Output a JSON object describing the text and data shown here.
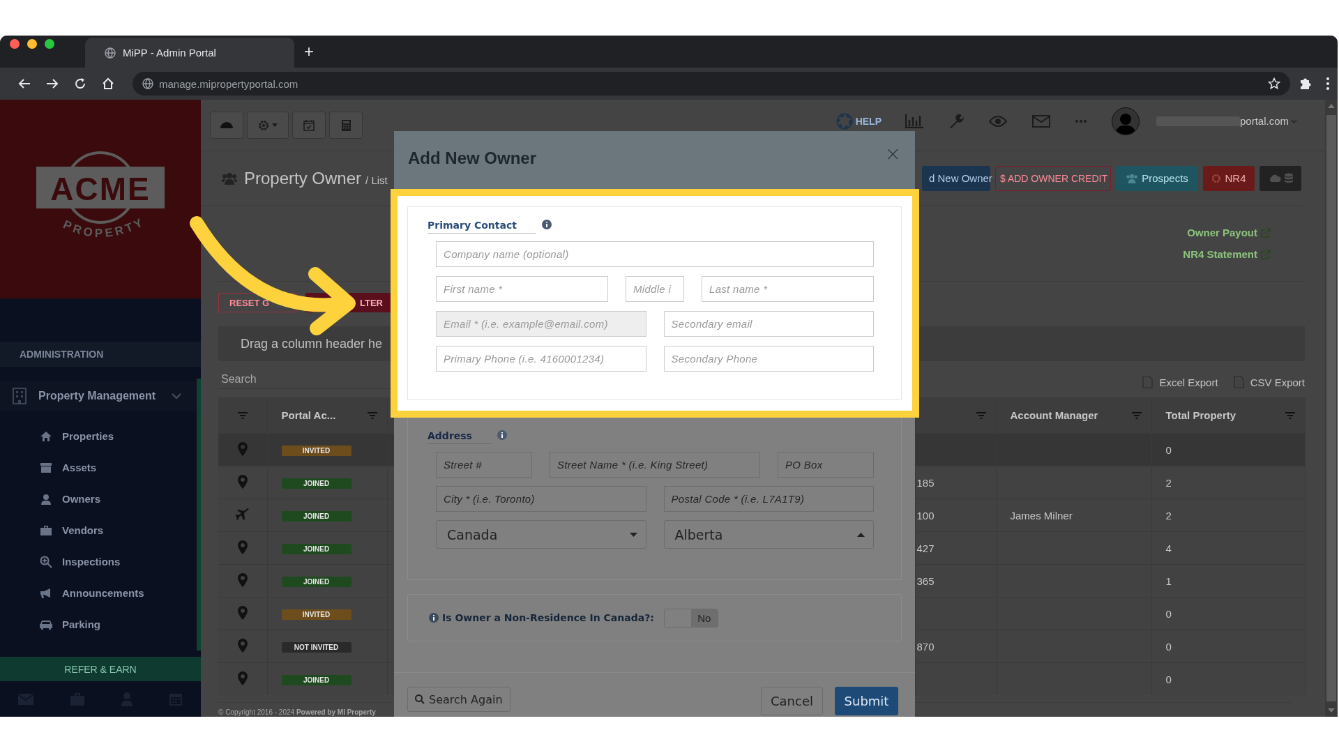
{
  "browser": {
    "tab_title": "MiPP - Admin Portal",
    "new_tab": "+",
    "url": "manage.mipropertyportal.com"
  },
  "logo": {
    "name": "ACME",
    "tagline": "PROPERTY"
  },
  "sidebar": {
    "section": "ADMINISTRATION",
    "group": {
      "label": "Property Management",
      "expanded": true
    },
    "items": [
      {
        "label": "Properties"
      },
      {
        "label": "Assets"
      },
      {
        "label": "Owners"
      },
      {
        "label": "Vendors"
      },
      {
        "label": "Inspections"
      },
      {
        "label": "Announcements"
      },
      {
        "label": "Parking"
      }
    ],
    "refer": "REFER & EARN"
  },
  "header": {
    "help": "HELP",
    "user_email": "portal.com"
  },
  "page": {
    "title": "Property Owner",
    "breadcrumb": "/ List",
    "actions": [
      {
        "label": "d New Owner",
        "kind": "primary"
      },
      {
        "label": "$ ADD OWNER CREDIT",
        "kind": "outline"
      },
      {
        "label": "Prospects",
        "kind": "info"
      },
      {
        "label": "NR4",
        "kind": "danger"
      },
      {
        "kind": "dark"
      }
    ],
    "links": [
      "Owner Payout",
      "NR4 Statement"
    ],
    "grid_buttons": [
      {
        "label": "RESET G",
        "kind": "outline"
      },
      {
        "label": "LTER",
        "kind": "solid"
      }
    ],
    "group_hint": "Drag a column header he",
    "search": {
      "placeholder": "Search"
    },
    "exports": [
      "Excel Export",
      "CSV Export"
    ]
  },
  "table": {
    "columns": [
      "Portal Ac...",
      "Account Manager",
      "Total Property"
    ],
    "rows": [
      {
        "kind": "pin",
        "status": "INVITED",
        "color": "#6e4d1c",
        "total": "0",
        "selected": true
      },
      {
        "kind": "pin",
        "status": "JOINED",
        "color": "#1f4a1f",
        "column_4": "185",
        "total": "2",
        "selected": false
      },
      {
        "kind": "plane",
        "status": "JOINED",
        "color": "#1f4a1f",
        "column_4": "100",
        "account_manager": "James Milner",
        "total": "2",
        "selected": false
      },
      {
        "kind": "pin",
        "status": "JOINED",
        "color": "#1f4a1f",
        "column_4": "427",
        "total": "4",
        "selected": false
      },
      {
        "kind": "pin",
        "status": "JOINED",
        "color": "#1f4a1f",
        "column_4": "365",
        "total": "1",
        "selected": false
      },
      {
        "kind": "pin",
        "status": "INVITED",
        "color": "#6e4d1c",
        "total": "0",
        "selected": false
      },
      {
        "kind": "pin",
        "status": "NOT INVITED",
        "color": "#2a2a2a",
        "column_4": "870",
        "total": "0",
        "selected": false
      },
      {
        "kind": "pin",
        "status": "JOINED",
        "color": "#1f4a1f",
        "total": "0",
        "selected": false
      }
    ]
  },
  "footer": "© Copyright 2016 - 2024 **Powered by MI Property**",
  "modal": {
    "title": "Add New Owner",
    "close": "×",
    "primary_contact": {
      "legend": "Primary Contact",
      "rows": [
        {
          "fields": [
            {
              "kind": "text",
              "placeholder": "Company name (optional)",
              "disabled": false
            }
          ]
        },
        {
          "fields": [
            {
              "kind": "text",
              "placeholder": "First name *",
              "disabled": false
            },
            {
              "kind": "text",
              "placeholder": "Middle i",
              "disabled": false
            },
            {
              "kind": "text",
              "placeholder": "Last name *",
              "disabled": false
            }
          ]
        },
        {
          "fields": [
            {
              "kind": "text",
              "placeholder": "Email * (i.e. example@email.com)",
              "disabled": true
            },
            {
              "kind": "text",
              "placeholder": "Secondary email",
              "disabled": false
            }
          ]
        },
        {
          "fields": [
            {
              "kind": "text",
              "placeholder": "Primary Phone (i.e. 4160001234)",
              "disabled": false
            },
            {
              "kind": "text",
              "placeholder": "Secondary Phone",
              "disabled": false
            }
          ]
        }
      ]
    },
    "address": {
      "legend": "Address",
      "rows": [
        {
          "fields": [
            {
              "kind": "text",
              "placeholder": "Street #",
              "disabled": false
            },
            {
              "kind": "text",
              "placeholder": "Street Name * (i.e. King Street)",
              "disabled": false
            },
            {
              "kind": "text",
              "placeholder": "PO Box",
              "disabled": false
            }
          ]
        },
        {
          "fields": [
            {
              "kind": "text",
              "placeholder": "City * (i.e. Toronto)",
              "disabled": false
            },
            {
              "kind": "text",
              "placeholder": "Postal Code * (i.e. L7A1T9)",
              "disabled": false
            }
          ]
        },
        {
          "fields": [
            {
              "kind": "select",
              "value": "Canada",
              "expanded": false
            },
            {
              "kind": "select",
              "value": "Alberta",
              "expanded": true
            }
          ]
        }
      ]
    },
    "non_resident": {
      "label": "Is Owner a Non-Residence In Canada?:",
      "on": false,
      "text": "No"
    },
    "buttons": {
      "search_again": "Search Again",
      "cancel": "Cancel",
      "submit": "Submit"
    }
  }
}
